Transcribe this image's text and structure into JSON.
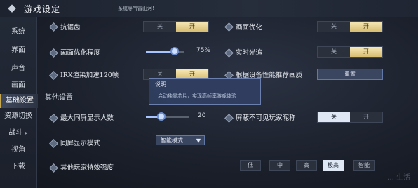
{
  "header": {
    "title": "游戏设定",
    "notice": "系统等气雷山河!"
  },
  "sidebar": {
    "items": [
      {
        "label": "系统"
      },
      {
        "label": "界面"
      },
      {
        "label": "声音"
      },
      {
        "label": "画面"
      },
      {
        "label": "基础设置"
      },
      {
        "label": "资源切换"
      },
      {
        "label": "战斗",
        "arrow": "▸"
      },
      {
        "label": "视角"
      },
      {
        "label": "下载"
      }
    ]
  },
  "toggle_labels": {
    "off": "关",
    "on": "开"
  },
  "settings": {
    "anti_aliasing": {
      "label": "抗锯齿",
      "state": "on"
    },
    "graphics_opt": {
      "label": "画面优化",
      "state": "on"
    },
    "graphics_opt_degree": {
      "label": "画面优化程度",
      "value_text": "75%",
      "fraction": 0.75
    },
    "realtime_light": {
      "label": "实时光追",
      "state": "on"
    },
    "irx": {
      "label": "IRX渲染加速120帧",
      "state": "on"
    },
    "recommend": {
      "label": "根据设备性能推荐画质",
      "button": "重置"
    }
  },
  "other": {
    "title": "其他设置",
    "max_players": {
      "label": "最大同屏显示人数",
      "value_text": "20",
      "fraction": 0.35
    },
    "hide_names": {
      "label": "屏蔽不可见玩家昵称",
      "state": "off"
    },
    "screen_mode": {
      "label": "同屏显示模式",
      "selected": "智能模式"
    },
    "effects": {
      "label": "其他玩家特效强度",
      "options": [
        "低",
        "中",
        "高",
        "极高",
        "智能"
      ],
      "selected_index": 3
    }
  },
  "tooltip": {
    "title": "说明",
    "text": "启动独显芯片，实现高帧率游戏体验"
  },
  "watermark": "… 生活"
}
